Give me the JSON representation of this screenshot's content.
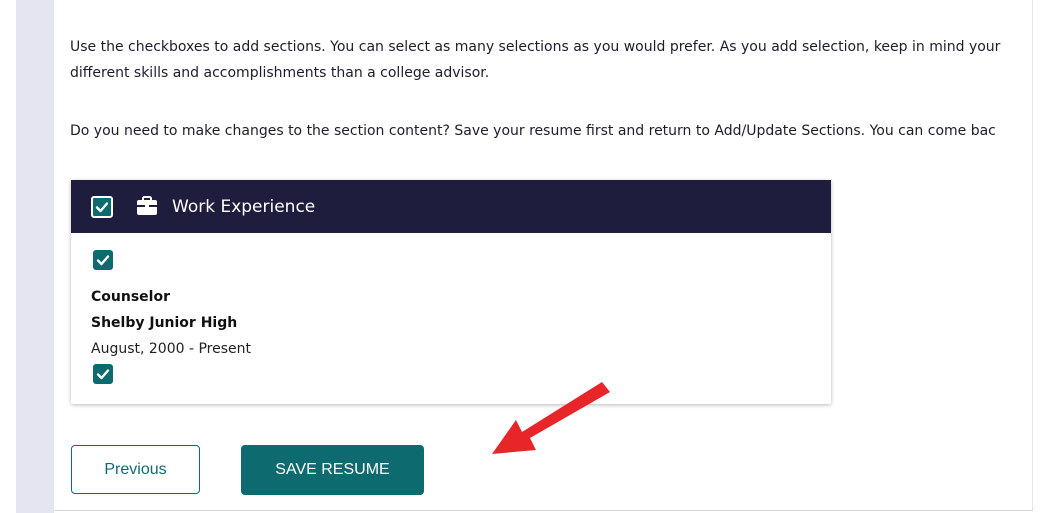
{
  "instructions": {
    "paragraph1_line1": "Use the checkboxes to add sections. You can select as many selections as you would prefer. As you add selection, keep in mind your",
    "paragraph1_line2": "different skills and accomplishments than a college advisor.",
    "paragraph2": "Do you need to make changes to the section content? Save your resume first and return to Add/Update Sections. You can come bac"
  },
  "section": {
    "title": "Work Experience",
    "header_checked": true,
    "icon": "briefcase-icon",
    "entry": {
      "title": "Counselor",
      "company": "Shelby Junior High",
      "dates": "August, 2000 - Present",
      "top_checked": true,
      "bottom_checked": true
    }
  },
  "buttons": {
    "previous_label": "Previous",
    "save_label": "SAVE RESUME"
  },
  "annotation": {
    "arrow_color": "#e8262a",
    "arrow_target": "save-resume-button"
  },
  "colors": {
    "header_bg": "#1f1d3d",
    "accent_teal": "#0d6b70",
    "rail": "#e5e4f1"
  }
}
